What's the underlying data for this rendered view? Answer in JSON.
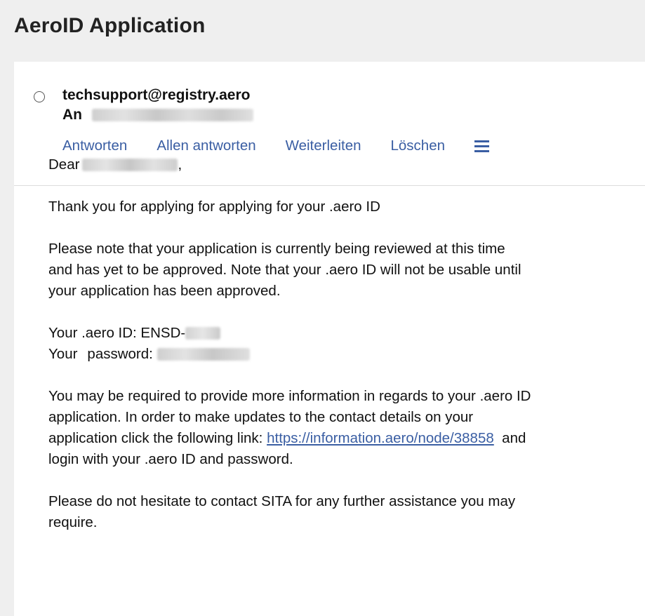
{
  "app": {
    "title": "AeroID Application"
  },
  "email": {
    "sender": "techsupport@registry.aero",
    "to_label": "An",
    "actions": {
      "reply": "Antworten",
      "reply_all": "Allen antworten",
      "forward": "Weiterleiten",
      "delete": "Löschen"
    },
    "menu_icon": "hamburger-menu-icon",
    "body": {
      "greeting_prefix": "Dear",
      "greeting_suffix": ",",
      "thanks": "Thank you for applying for applying for your .aero ID",
      "review_line1": "Please note that your application is currently being reviewed at this time",
      "review_line2": "and has yet to be approved. Note that your .aero ID will not be usable until",
      "review_line3": "your application has been approved.",
      "id_label": "Your .aero ID: ENSD-",
      "password_label_a": "Your",
      "password_label_b": "password:",
      "info_line1": "You may be required to provide more information in regards to your .aero ID",
      "info_line2": "application. In order to make updates to the contact details on your",
      "info_line3_prefix": "application click the following link:",
      "info_link": "https://information.aero/node/38858",
      "info_line3_suffix": "and",
      "info_line4": "login with your .aero ID and password.",
      "closing_line1": "Please do not hesitate to contact SITA for any further assistance you may",
      "closing_line2": "require."
    }
  },
  "colors": {
    "page_background": "#efefef",
    "card_background": "#ffffff",
    "action_link": "#3a5ea3",
    "text": "#111111"
  }
}
